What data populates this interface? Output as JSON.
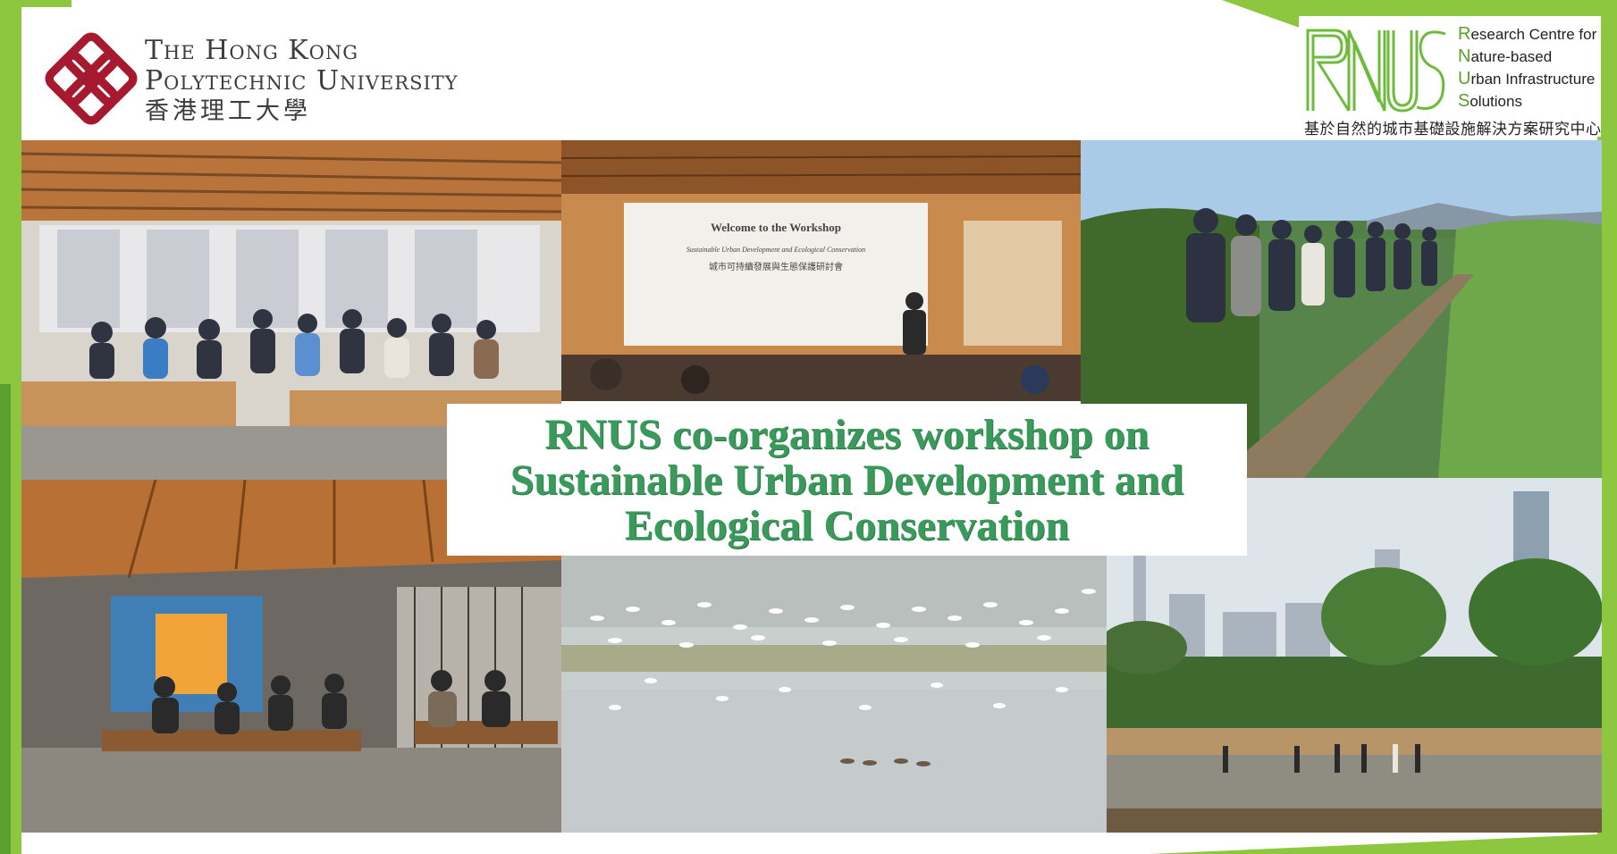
{
  "header": {
    "university": {
      "name_line1": "The Hong Kong",
      "name_line2": "Polytechnic University",
      "name_zh": "香港理工大學"
    },
    "centre": {
      "logo_text": "RNUS",
      "lines": [
        {
          "initial": "R",
          "rest": "esearch Centre for"
        },
        {
          "initial": "N",
          "rest": "ature-based"
        },
        {
          "initial": "U",
          "rest": "rban Infrastructure"
        },
        {
          "initial": "S",
          "rest": "olutions"
        }
      ],
      "name_zh": "基於自然的城市基礎設施解決方案研究中心"
    }
  },
  "photos": {
    "workshop_screen": {
      "title": "Welcome to the Workshop",
      "subtitle": "Sustainable Urban Development and Ecological Conservation",
      "subtitle_zh": "城市可持續發展與生態保護研討會"
    }
  },
  "headline": {
    "line1": "RNUS co-organizes workshop on",
    "line2": "Sustainable Urban Development and",
    "line3": "Ecological Conservation"
  },
  "colors": {
    "frame_green": "#8dc63f",
    "headline_green": "#3a9a5b",
    "polyu_red": "#a6192e"
  }
}
